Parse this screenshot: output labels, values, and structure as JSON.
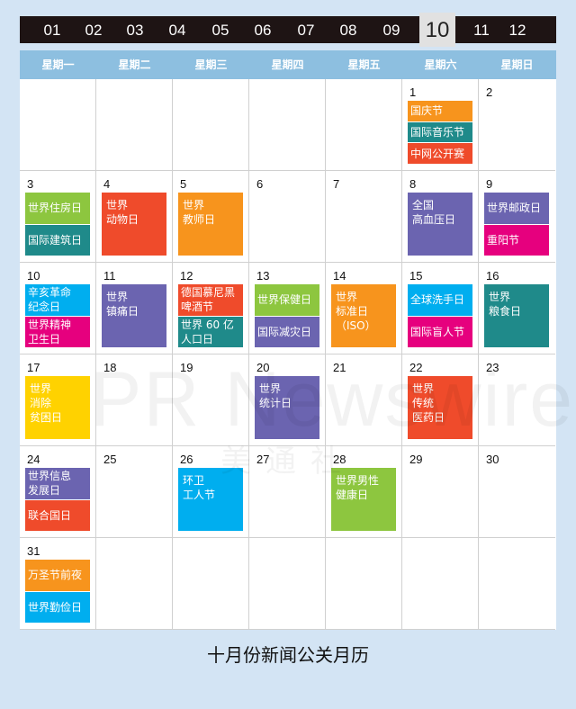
{
  "months": [
    "01",
    "02",
    "03",
    "04",
    "05",
    "06",
    "07",
    "08",
    "09",
    "10",
    "11",
    "12"
  ],
  "active_month": "10",
  "weekdays": [
    "星期一",
    "星期二",
    "星期三",
    "星期四",
    "星期五",
    "星期六",
    "星期日"
  ],
  "first_weekday_index": 5,
  "days_in_month": 31,
  "colors": {
    "orange": "#f7941d",
    "teal": "#1f8a8a",
    "red": "#ef4b2b",
    "green": "#8dc63f",
    "purple": "#6b64b0",
    "pink": "#e6007e",
    "sky": "#00aeef",
    "yellow": "#ffd200"
  },
  "events": {
    "1": [
      {
        "text": "国庆节",
        "color": "orange"
      },
      {
        "text": "国际音乐节",
        "color": "teal"
      },
      {
        "text": "中网公开赛",
        "color": "red"
      }
    ],
    "3": [
      {
        "text": "世界住房日",
        "color": "green"
      },
      {
        "text": "国际建筑日",
        "color": "teal"
      }
    ],
    "4": [
      {
        "text": "世界\n动物日",
        "color": "red"
      }
    ],
    "5": [
      {
        "text": "世界\n教师日",
        "color": "orange"
      }
    ],
    "8": [
      {
        "text": "全国\n高血压日",
        "color": "purple"
      }
    ],
    "9": [
      {
        "text": "世界邮政日",
        "color": "purple"
      },
      {
        "text": "重阳节",
        "color": "pink"
      }
    ],
    "10": [
      {
        "text": "辛亥革命\n纪念日",
        "color": "sky"
      },
      {
        "text": "世界精神\n卫生日",
        "color": "pink"
      }
    ],
    "11": [
      {
        "text": "世界\n镇痛日",
        "color": "purple"
      }
    ],
    "12": [
      {
        "text": "德国慕尼黑\n啤酒节",
        "color": "red"
      },
      {
        "text": "世界 60 亿\n人口日",
        "color": "teal"
      }
    ],
    "13": [
      {
        "text": "世界保健日",
        "color": "green"
      },
      {
        "text": "国际减灾日",
        "color": "purple"
      }
    ],
    "14": [
      {
        "text": "世界\n标准日\n（ISO）",
        "color": "orange"
      }
    ],
    "15": [
      {
        "text": "全球洗手日",
        "color": "sky"
      },
      {
        "text": "国际盲人节",
        "color": "pink"
      }
    ],
    "16": [
      {
        "text": "世界\n粮食日",
        "color": "teal"
      }
    ],
    "17": [
      {
        "text": "世界\n消除\n贫困日",
        "color": "yellow"
      }
    ],
    "20": [
      {
        "text": "世界\n统计日",
        "color": "purple"
      }
    ],
    "22": [
      {
        "text": "世界\n传统\n医药日",
        "color": "red"
      }
    ],
    "24": [
      {
        "text": "世界信息\n发展日",
        "color": "purple"
      },
      {
        "text": "联合国日",
        "color": "red"
      }
    ],
    "26": [
      {
        "text": "环卫\n工人节",
        "color": "sky"
      }
    ],
    "28": [
      {
        "text": "世界男性\n健康日",
        "color": "green"
      }
    ],
    "31": [
      {
        "text": "万圣节前夜",
        "color": "orange"
      },
      {
        "text": "世界勤俭日",
        "color": "sky"
      }
    ]
  },
  "watermark": "PR Newswire 美通社",
  "title": "十月份新闻公关月历"
}
